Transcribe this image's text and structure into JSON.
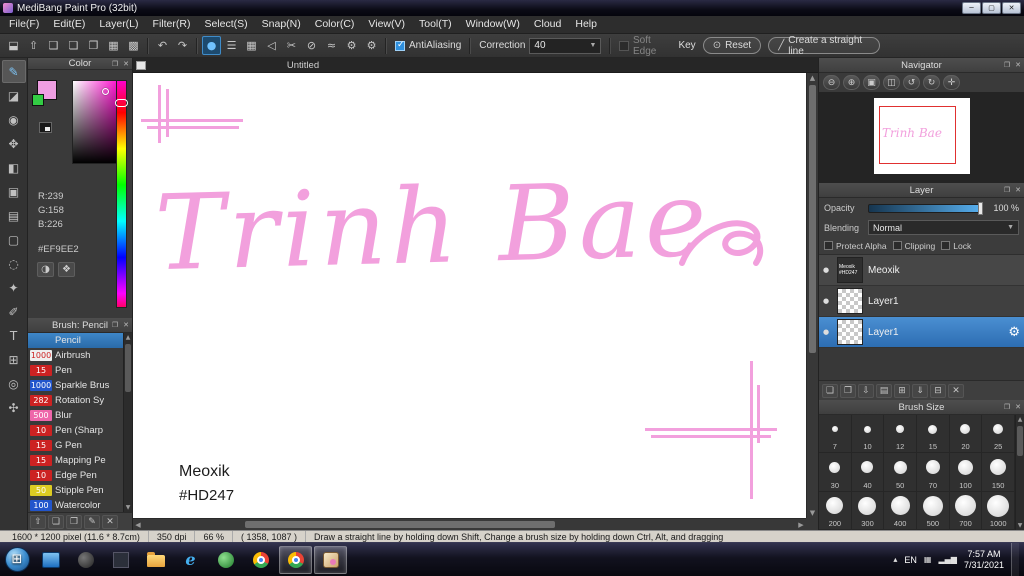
{
  "window": {
    "title": "MediBang Paint Pro (32bit)",
    "menu": [
      "File(F)",
      "Edit(E)",
      "Layer(L)",
      "Filter(R)",
      "Select(S)",
      "Snap(N)",
      "Color(C)",
      "View(V)",
      "Tool(T)",
      "Window(W)",
      "Cloud",
      "Help"
    ],
    "controls": {
      "minimize": "─",
      "maximize": "▢",
      "close": "✕"
    }
  },
  "toolbar": {
    "file_icons": [
      {
        "name": "save-icon",
        "glyph": "⬓"
      },
      {
        "name": "publish-icon",
        "glyph": "⇧"
      },
      {
        "name": "comment-icon",
        "glyph": "❑"
      },
      {
        "name": "copy-icon",
        "glyph": "❏"
      },
      {
        "name": "paste-icon",
        "glyph": "❐"
      },
      {
        "name": "grid-icon",
        "glyph": "▦"
      },
      {
        "name": "material-panel-icon",
        "glyph": "▩"
      }
    ],
    "history_icons": [
      {
        "name": "undo-icon",
        "glyph": "↶"
      },
      {
        "name": "redo-icon",
        "glyph": "↷"
      }
    ],
    "shape_icons": [
      {
        "name": "brush-circle-icon",
        "glyph": "●",
        "selected": true
      },
      {
        "name": "parallel-lines-icon",
        "glyph": "☰"
      },
      {
        "name": "grid-snap-icon",
        "glyph": "▦"
      },
      {
        "name": "polygon-icon",
        "glyph": "◁"
      },
      {
        "name": "scissors-icon",
        "glyph": "✂"
      },
      {
        "name": "ellipse-icon",
        "glyph": "⊘"
      },
      {
        "name": "curve-icon",
        "glyph": "≈"
      },
      {
        "name": "gear-icon",
        "glyph": "⚙"
      },
      {
        "name": "settings-gear-icon",
        "glyph": "⚙"
      }
    ],
    "antialiasing_label": "AntiAliasing",
    "correction_label": "Correction",
    "correction_value": "40",
    "soft_edge_label": "Soft Edge",
    "key_label": "Key",
    "reset_icon": "⊙",
    "reset_label": "Reset",
    "straight_line_icon": "╱",
    "straight_line_label": "Create a straight line"
  },
  "tool_palette": [
    {
      "name": "pen-tool",
      "glyph": "✎",
      "selected": true
    },
    {
      "name": "eraser-tool",
      "glyph": "◪"
    },
    {
      "name": "finger-tool",
      "glyph": "◉"
    },
    {
      "name": "move-tool",
      "glyph": "✥"
    },
    {
      "name": "fill-tool",
      "glyph": "◧"
    },
    {
      "name": "bucket-tool",
      "glyph": "▣"
    },
    {
      "name": "gradient-tool",
      "glyph": "▤"
    },
    {
      "name": "select-tool",
      "glyph": "▢"
    },
    {
      "name": "lasso-tool",
      "glyph": "◌"
    },
    {
      "name": "wand-tool",
      "glyph": "✦"
    },
    {
      "name": "select-pen-tool",
      "glyph": "✐"
    },
    {
      "name": "text-tool",
      "glyph": "T"
    },
    {
      "name": "frame-tool",
      "glyph": "⊞"
    },
    {
      "name": "eyedropper-tool",
      "glyph": "◎"
    },
    {
      "name": "hand-tool",
      "glyph": "✣"
    }
  ],
  "color_panel": {
    "title": "Color",
    "r": "R:239",
    "g": "G:158",
    "b": "B:226",
    "hex": "#EF9EE2",
    "current_color": "#EF9EE2",
    "secondary_color": "#33cc44",
    "palette_icons": [
      {
        "name": "color-wheel-icon",
        "glyph": "◑"
      },
      {
        "name": "palette-icon",
        "glyph": "❖"
      }
    ]
  },
  "brush_panel": {
    "title": "Brush: Pencil",
    "items": [
      {
        "size": "",
        "name": "Pencil",
        "badge": "",
        "text": "",
        "selected": true
      },
      {
        "size": "1000",
        "name": "Airbrush",
        "badge": "#efefef",
        "text": "#cc2222"
      },
      {
        "size": "15",
        "name": "Pen",
        "badge": "#cc2222",
        "text": "#ffffff"
      },
      {
        "size": "1000",
        "name": "Sparkle Brus",
        "badge": "#2255cc",
        "text": "#ffffff"
      },
      {
        "size": "282",
        "name": "Rotation Sy",
        "badge": "#cc2222",
        "text": "#ffffff"
      },
      {
        "size": "500",
        "name": "Blur",
        "badge": "#ee66aa",
        "text": "#ffffff"
      },
      {
        "size": "10",
        "name": "Pen (Sharp",
        "badge": "#cc2222",
        "text": "#ffffff"
      },
      {
        "size": "15",
        "name": "G Pen",
        "badge": "#cc2222",
        "text": "#ffffff"
      },
      {
        "size": "15",
        "name": "Mapping Pe",
        "badge": "#cc2222",
        "text": "#ffffff"
      },
      {
        "size": "10",
        "name": "Edge Pen",
        "badge": "#cc2222",
        "text": "#ffffff"
      },
      {
        "size": "50",
        "name": "Stipple Pen",
        "badge": "#ddcc22",
        "text": "#ffffff"
      },
      {
        "size": "100",
        "name": "Watercolor",
        "badge": "#2255cc",
        "text": "#ffffff"
      }
    ],
    "footer_icons": [
      {
        "name": "raise-brush-icon",
        "glyph": "⇧"
      },
      {
        "name": "add-brush-icon",
        "glyph": "❏"
      },
      {
        "name": "duplicate-brush-icon",
        "glyph": "❐"
      },
      {
        "name": "edit-brush-icon",
        "glyph": "✎"
      },
      {
        "name": "delete-brush-icon",
        "glyph": "✕"
      }
    ]
  },
  "canvas": {
    "tab_title": "Untitled",
    "artwork_text": "Trinh Bae",
    "artwork_color": "#f2a0dd",
    "signature_line1": "Meoxik",
    "signature_line2": "#HD247"
  },
  "navigator": {
    "title": "Navigator",
    "buttons": [
      {
        "name": "zoom-out-icon",
        "glyph": "⊖"
      },
      {
        "name": "zoom-in-icon",
        "glyph": "⊕"
      },
      {
        "name": "fit-window-icon",
        "glyph": "▣"
      },
      {
        "name": "actual-size-icon",
        "glyph": "◫"
      },
      {
        "name": "rotate-left-icon",
        "glyph": "↺"
      },
      {
        "name": "rotate-right-icon",
        "glyph": "↻"
      },
      {
        "name": "reset-view-icon",
        "glyph": "✛"
      }
    ]
  },
  "layer_panel": {
    "title": "Layer",
    "opacity_label": "Opacity",
    "opacity_value": "100 %",
    "blending_label": "Blending",
    "blending_value": "Normal",
    "protect_alpha_label": "Protect Alpha",
    "clipping_label": "Clipping",
    "lock_label": "Lock",
    "layers": [
      {
        "name": "Meoxik",
        "thumb": "text",
        "thumb_line1": "Meoxik",
        "thumb_line2": "#HD247",
        "selected": false
      },
      {
        "name": "Layer1",
        "thumb": "checker",
        "selected": false
      },
      {
        "name": "Layer1",
        "thumb": "checker",
        "selected": true
      }
    ],
    "footer_icons": [
      {
        "name": "new-layer-icon",
        "glyph": "❏"
      },
      {
        "name": "duplicate-layer-icon",
        "glyph": "❐"
      },
      {
        "name": "transfer-layer-icon",
        "glyph": "⇩"
      },
      {
        "name": "new-folder-icon",
        "glyph": "▤"
      },
      {
        "name": "combine-layer-icon",
        "glyph": "⊞"
      },
      {
        "name": "merge-down-icon",
        "glyph": "⇓"
      },
      {
        "name": "clear-layer-icon",
        "glyph": "⊟"
      },
      {
        "name": "delete-layer-icon",
        "glyph": "✕"
      }
    ]
  },
  "brush_size_panel": {
    "title": "Brush Size",
    "sizes": [
      7,
      10,
      12,
      15,
      20,
      25,
      30,
      40,
      50,
      70,
      100,
      150,
      200,
      300,
      400,
      500,
      700,
      1000
    ]
  },
  "status_bar": {
    "size": "1600 * 1200 pixel   (11.6 * 8.7cm)",
    "dpi": "350 dpi",
    "zoom": "66 %",
    "coords": "( 1358, 1087 )",
    "hint": "Draw a straight line by holding down Shift, Change a brush size by holding down Ctrl, Alt, and dragging"
  },
  "taskbar": {
    "start_icon": "⊞",
    "apps": [
      {
        "name": "taskbar-app-remote",
        "kind": "monitor"
      },
      {
        "name": "taskbar-app-dark-1",
        "kind": "disc"
      },
      {
        "name": "taskbar-app-dark-2",
        "kind": "squareapp"
      },
      {
        "name": "taskbar-app-folder",
        "kind": "folder"
      },
      {
        "name": "taskbar-app-internet-explorer",
        "kind": "ie"
      },
      {
        "name": "taskbar-app-green",
        "kind": "green"
      },
      {
        "name": "taskbar-app-chrome",
        "kind": "chrome"
      },
      {
        "name": "taskbar-app-chrome-2",
        "kind": "chrome",
        "active": true
      },
      {
        "name": "taskbar-app-medibang",
        "kind": "medibang",
        "active": true
      }
    ],
    "language": "EN",
    "time": "7:57 AM",
    "date": "7/31/2021"
  }
}
